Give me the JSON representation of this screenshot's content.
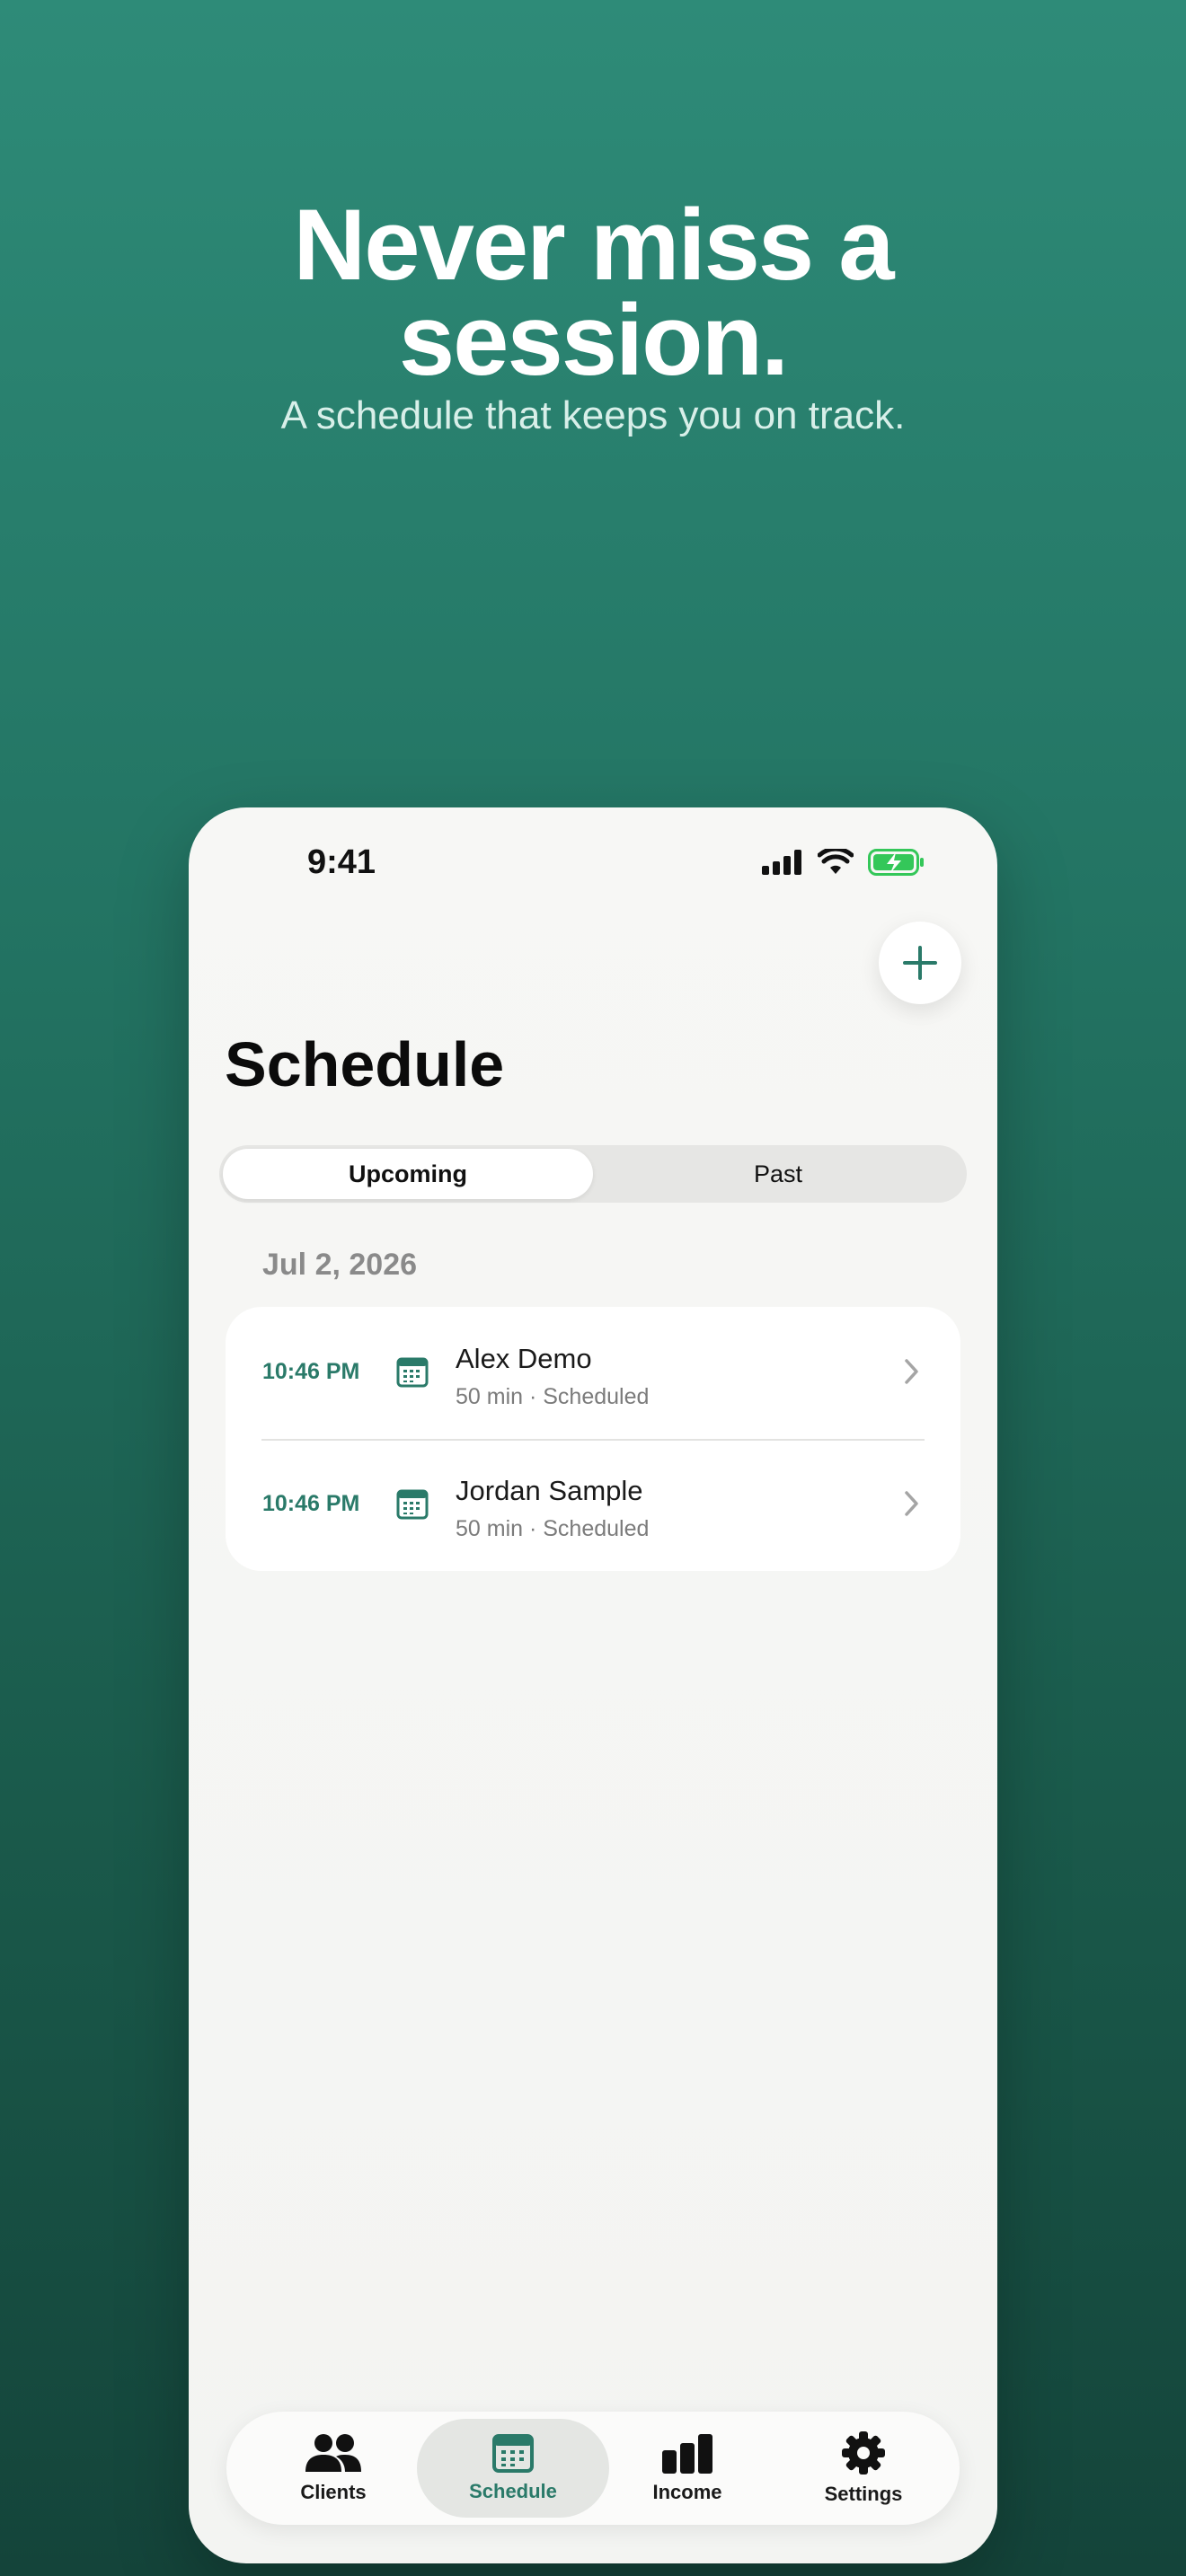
{
  "hero": {
    "title_line1": "Never miss a",
    "title_line2": "session.",
    "subtitle": "A schedule that keeps you on track."
  },
  "status_bar": {
    "time": "9:41"
  },
  "screen": {
    "title": "Schedule",
    "segments": {
      "upcoming": "Upcoming",
      "past": "Past",
      "selected": "Upcoming"
    },
    "date_header": "Jul 2, 2026",
    "sessions": [
      {
        "time": "10:46 PM",
        "name": "Alex Demo",
        "meta": "50 min · Scheduled"
      },
      {
        "time": "10:46 PM",
        "name": "Jordan Sample",
        "meta": "50 min · Scheduled"
      }
    ]
  },
  "tabbar": {
    "clients": "Clients",
    "schedule": "Schedule",
    "income": "Income",
    "settings": "Settings",
    "active": "Schedule"
  },
  "colors": {
    "accent": "#2a7a69",
    "battery": "#34c759"
  }
}
